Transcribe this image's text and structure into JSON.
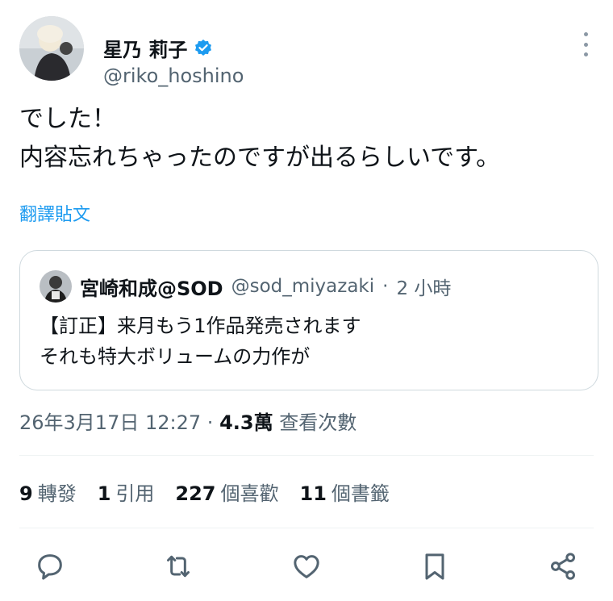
{
  "author": {
    "display_name": "星乃 莉子",
    "handle": "@riko_hoshino",
    "verified": true,
    "avatar_icon": "avatar-photo-icon"
  },
  "tweet": {
    "lines": [
      "でした！",
      "内容忘れちゃったのですが出るらしいです。"
    ],
    "translate_label": "翻譯貼文"
  },
  "quoted_tweet": {
    "display_name": "宮崎和成@SOD",
    "handle": "@sod_miyazaki",
    "time_sep": "·",
    "time": "2 小時",
    "lines": [
      "【訂正】来月もう1作品発売されます",
      "それも特大ボリュームの力作が"
    ]
  },
  "meta": {
    "datetime": "26年3月17日 12:27",
    "sep": "·",
    "views_count": "4.3萬",
    "views_label": "查看次數"
  },
  "stats": {
    "retweets_count": "9",
    "retweets_label": "轉發",
    "quotes_count": "1",
    "quotes_label": "引用",
    "likes_count": "227",
    "likes_label": "個喜歡",
    "bookmarks_count": "11",
    "bookmarks_label": "個書籤"
  },
  "colors": {
    "link": "#1d9bf0",
    "verified_badge": "#1d9bf0",
    "secondary_text": "#536471",
    "border": "#cfd9de"
  }
}
